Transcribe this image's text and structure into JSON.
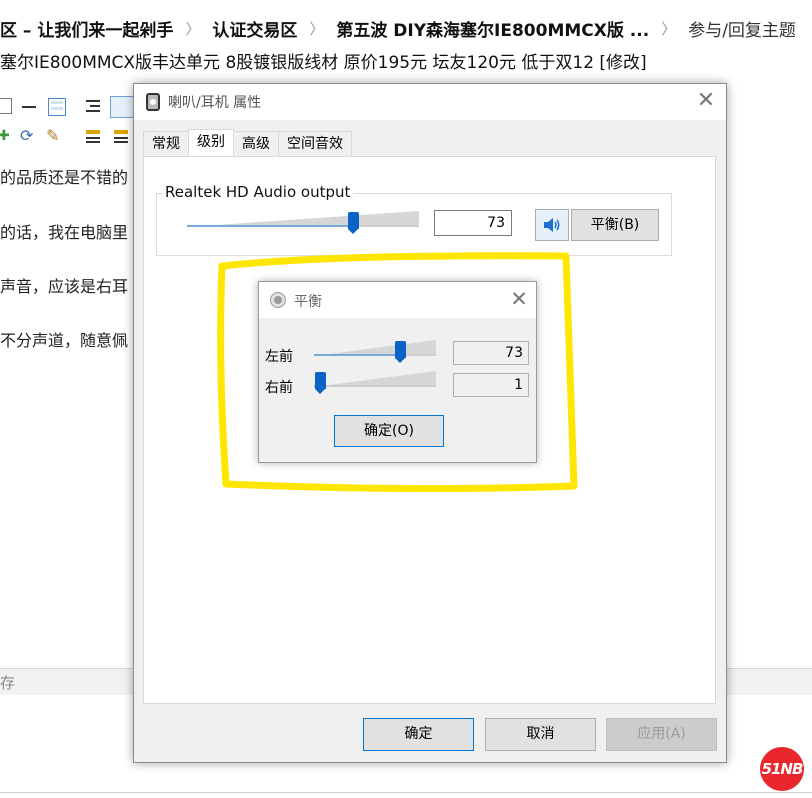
{
  "breadcrumb": {
    "items": [
      "区 – 让我们来一起剁手",
      "认证交易区",
      "第五波 DIY森海塞尔IE800MMCX版 ...",
      "参与/回复主题"
    ]
  },
  "post": {
    "title": "塞尔IE800MMCX版丰达单元 8股镀银版线材 原价195元 坛友120元 低于双12 [修改]",
    "lines": [
      "的品质还是不错的",
      "的话，我在电脑里",
      "声音，应该是右耳",
      "不分声道，随意佩"
    ],
    "save_text": "存"
  },
  "logo": {
    "text": "51NB"
  },
  "properties_dialog": {
    "title": "喇叭/耳机 属性",
    "tabs": [
      {
        "label": "常规",
        "active": false
      },
      {
        "label": "级别",
        "active": true
      },
      {
        "label": "高级",
        "active": false
      },
      {
        "label": "空间音效",
        "active": false
      }
    ],
    "device_label": "Realtek HD Audio output",
    "volume": {
      "value": "73",
      "percent": 73
    },
    "balance_button": "平衡(B)",
    "footer": {
      "ok": "确定",
      "cancel": "取消",
      "apply": "应用(A)"
    }
  },
  "balance_dialog": {
    "title": "平衡",
    "channels": [
      {
        "label": "左前",
        "value": "73",
        "percent": 73
      },
      {
        "label": "右前",
        "value": "1",
        "percent": 1
      }
    ],
    "ok_button": "确定(O)"
  },
  "colors": {
    "accent": "#0a64c8",
    "highlight": "#ffe600",
    "logo_red": "#e8262b"
  }
}
